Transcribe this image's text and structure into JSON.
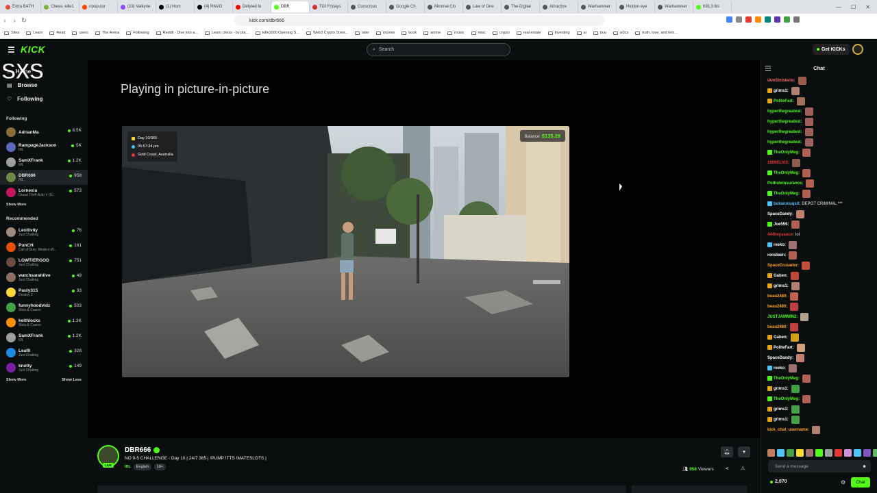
{
  "browser": {
    "tabs": [
      {
        "label": "Extra BATH",
        "color": "#e74c3c"
      },
      {
        "label": "Chess: kille1",
        "color": "#7cb342"
      },
      {
        "label": "r/popular",
        "color": "#ff4500"
      },
      {
        "label": "(23) Valkyrie",
        "color": "#9146ff"
      },
      {
        "label": "(1) Hom",
        "color": "#000000"
      },
      {
        "label": "(4) RNVO",
        "color": "#000000"
      },
      {
        "label": "Defyted fo",
        "color": "#ff0000"
      },
      {
        "label": "DBR",
        "color": "#53fc18",
        "active": true
      },
      {
        "label": "TGI Fridays",
        "color": "#d32f2f"
      },
      {
        "label": "Conscious",
        "color": "#555555"
      },
      {
        "label": "Google Ch",
        "color": "#555555"
      },
      {
        "label": "Minimal Clo",
        "color": "#555555"
      },
      {
        "label": "Law of One",
        "color": "#555555"
      },
      {
        "label": "The Digital",
        "color": "#555555"
      },
      {
        "label": "Attractive",
        "color": "#555555"
      },
      {
        "label": "Warhammer",
        "color": "#555555"
      },
      {
        "label": "Hidden eye",
        "color": "#555555"
      },
      {
        "label": "Warhammer",
        "color": "#555555"
      },
      {
        "label": "KBL3 Bo",
        "color": "#53fc18"
      }
    ],
    "url": "kick.com/dbr666",
    "bookmarks": [
      "Sites",
      "Learn",
      "Read",
      "users",
      "The Arena",
      "Following",
      "Reddit - Dive into a...",
      "Learn chess - by pla...",
      "kille1000 Opening S...",
      "Web3 Crypto Strea...",
      "later",
      "movies",
      "book",
      "anime",
      "music",
      "misc",
      "crypto",
      "real estate",
      "Investing",
      "ai",
      "buy",
      "w3cs",
      "truth, love, and tem..."
    ]
  },
  "header": {
    "logo": "KICK",
    "search_placeholder": "Search",
    "get_kicks": "Get KICKs"
  },
  "sidebar": {
    "nav": [
      {
        "label": "Home",
        "icon": "home-icon"
      },
      {
        "label": "Browse",
        "icon": "browse-icon"
      },
      {
        "label": "Following",
        "icon": "heart-icon"
      }
    ],
    "following_title": "Following",
    "following": [
      {
        "name": "AdrianMa",
        "category": "",
        "viewers": "8.5K",
        "color": "#8a6d3b"
      },
      {
        "name": "RampageJackson",
        "category": "IRL",
        "viewers": "5K",
        "color": "#5c6bc0"
      },
      {
        "name": "SamXFrank",
        "category": "IRL",
        "viewers": "1.2K",
        "color": "#9e9e9e"
      },
      {
        "name": "DBR666",
        "category": "IRL",
        "viewers": "958",
        "color": "#6d8b4a",
        "active": true
      },
      {
        "name": "Lornexia",
        "category": "Grand Theft Auto V (G...",
        "viewers": "573",
        "color": "#c2185b"
      }
    ],
    "show_more": "Show More",
    "recommended_title": "Recommended",
    "recommended": [
      {
        "name": "Lexitivity",
        "category": "Just Chatting",
        "viewers": "76",
        "color": "#a1887f"
      },
      {
        "name": "PunCH",
        "category": "Call of Duty: Modern W...",
        "viewers": "161",
        "color": "#e65100"
      },
      {
        "name": "LOWTIERGOD",
        "category": "Just Chatting",
        "viewers": "751",
        "color": "#6d4c41"
      },
      {
        "name": "watchsarahlive",
        "category": "Just Chatting",
        "viewers": "49",
        "color": "#8d6e63"
      },
      {
        "name": "Pauly315",
        "category": "Destiny 2",
        "viewers": "33",
        "color": "#fdd835"
      },
      {
        "name": "funnyhoodvidz",
        "category": "Slots & Casino",
        "viewers": "503",
        "color": "#43a047"
      },
      {
        "name": "keithlocks",
        "category": "Slots & Casino",
        "viewers": "1.3K",
        "color": "#ff8f00"
      },
      {
        "name": "SamXFrank",
        "category": "IRL",
        "viewers": "1.2K",
        "color": "#9e9e9e"
      },
      {
        "name": "Leafit",
        "category": "Just Chatting",
        "viewers": "328",
        "color": "#1e88e5"
      },
      {
        "name": "knotty",
        "category": "Just Chatting",
        "viewers": "149",
        "color": "#7b1fa2"
      }
    ],
    "show_more_2": "Show More",
    "show_less": "Show Less",
    "watermark": "SXS"
  },
  "player": {
    "pip_text": "Playing in picture-in-picture",
    "overlay_day": "Day 10/365",
    "overlay_time": "05:57:34 pm",
    "overlay_location": "Gold Coast, Australia",
    "balance_label": "Balance:",
    "balance_value": "$135.28"
  },
  "stream": {
    "streamer": "DBR666",
    "live": "LIVE",
    "title": "NO 9-5 CHALLENGE - Day 10 | 24/7 365 | !PUMP !TTS !MATESLOTS |",
    "category": "IRL",
    "tags": [
      "English",
      "18+"
    ],
    "viewers": "958",
    "viewers_label": "Viewers"
  },
  "chat": {
    "title": "Chat",
    "messages": [
      {
        "user": "iAmSinisterio:",
        "color": "#ff6b6b",
        "text": "",
        "emote": "#9c5b4a",
        "badge": ""
      },
      {
        "user": "grims1:",
        "color": "#ffffff",
        "text": "",
        "emote": "#b08070",
        "badge": "#e6a817"
      },
      {
        "user": "PoliteFart:",
        "color": "#53fc18",
        "text": "",
        "emote": "#a0705a",
        "badge": "#e6a817"
      },
      {
        "user": "hyperthegreatest:",
        "color": "#53fc18",
        "text": "",
        "emote": "#a0605a",
        "badge": ""
      },
      {
        "user": "hyperthegreatest:",
        "color": "#53fc18",
        "text": "",
        "emote": "#a0605a",
        "badge": ""
      },
      {
        "user": "hyperthegreatest:",
        "color": "#53fc18",
        "text": "",
        "emote": "#a0605a",
        "badge": ""
      },
      {
        "user": "hyperthegreatest:",
        "color": "#53fc18",
        "text": "",
        "emote": "#a0605a",
        "badge": ""
      },
      {
        "user": "TheOnlyMeg:",
        "color": "#53fc18",
        "text": "",
        "emote": "#b06050",
        "badge": "#53fc18"
      },
      {
        "user": "1909ELVIS:",
        "color": "#e53935",
        "text": "",
        "emote": "#8a6050",
        "badge": ""
      },
      {
        "user": "TheOnlyMeg:",
        "color": "#53fc18",
        "text": "",
        "emote": "#b06050",
        "badge": "#53fc18"
      },
      {
        "user": "Potholeinsurance:",
        "color": "#53fc18",
        "text": "",
        "emote": "#b06050",
        "badge": ""
      },
      {
        "user": "TheOnlyMeg:",
        "color": "#53fc18",
        "text": "",
        "emote": "#b06050",
        "badge": "#53fc18"
      },
      {
        "user": "bukanmuqsit:",
        "color": "#4fc3f7",
        "text": "DEPOT CRIMINAL ***",
        "emote": "",
        "badge": "#4fc3f7"
      },
      {
        "user": "SpaceDandy:",
        "color": "#ffffff",
        "text": "",
        "emote": "#c08070",
        "badge": ""
      },
      {
        "user": "Joe559:",
        "color": "#ffffff",
        "text": "",
        "emote": "#b06050",
        "badge": "#53fc18"
      },
      {
        "user": "444keysauce:",
        "color": "#e53935",
        "text": "lol",
        "emote": "",
        "badge": ""
      },
      {
        "user": "reeko:",
        "color": "#ffffff",
        "text": "",
        "emote": "#a07070",
        "badge": "#4fc3f7"
      },
      {
        "user": "ronsteen:",
        "color": "#ffffff",
        "text": "",
        "emote": "#b06050",
        "badge": ""
      },
      {
        "user": "SpaceCrusader:",
        "color": "#ffa726",
        "text": "",
        "emote": "#c0503a",
        "badge": ""
      },
      {
        "user": "Gaben:",
        "color": "#ffffff",
        "text": "",
        "emote": "#c04a3a",
        "badge": "#e6a817"
      },
      {
        "user": "grims1:",
        "color": "#ffffff",
        "text": "",
        "emote": "#b08070",
        "badge": "#e6a817"
      },
      {
        "user": "beau2480:",
        "color": "#ffa726",
        "text": "",
        "emote": "#c06050",
        "badge": ""
      },
      {
        "user": "beau2480:",
        "color": "#ffa726",
        "text": "",
        "emote": "#c04040",
        "badge": ""
      },
      {
        "user": "JUSTJAMMIN2:",
        "color": "#53fc18",
        "text": "",
        "emote": "#b0a090",
        "badge": ""
      },
      {
        "user": "beau2480:",
        "color": "#ffa726",
        "text": "",
        "emote": "#c04040",
        "badge": ""
      },
      {
        "user": "Gaben:",
        "color": "#ffffff",
        "text": "",
        "emote": "#d4a017",
        "badge": "#e6a817"
      },
      {
        "user": "PoliteFart:",
        "color": "#ffffff",
        "text": "",
        "emote": "#d0a080",
        "badge": "#e6a817"
      },
      {
        "user": "SpaceDandy:",
        "color": "#ffffff",
        "text": "",
        "emote": "#c08070",
        "badge": ""
      },
      {
        "user": "reeko:",
        "color": "#ffffff",
        "text": "",
        "emote": "#a07070",
        "badge": "#4fc3f7"
      },
      {
        "user": "TheOnlyMeg:",
        "color": "#53fc18",
        "text": "",
        "emote": "#b06050",
        "badge": "#53fc18"
      },
      {
        "user": "grims1:",
        "color": "#ffffff",
        "text": "",
        "emote": "#43a047",
        "badge": "#e6a817"
      },
      {
        "user": "TheOnlyMeg:",
        "color": "#53fc18",
        "text": "",
        "emote": "#b06050",
        "badge": "#53fc18"
      },
      {
        "user": "grims1:",
        "color": "#ffffff",
        "text": "",
        "emote": "#43a047",
        "badge": "#e6a817"
      },
      {
        "user": "grims1:",
        "color": "#ffffff",
        "text": "",
        "emote": "#43a047",
        "badge": "#e6a817"
      },
      {
        "user": "kick_chat_username:",
        "color": "#ffa726",
        "text": "",
        "emote": "#b08070",
        "badge": ""
      }
    ],
    "input_placeholder": "Send a message",
    "kicks_balance": "2,070",
    "send_label": "Chat"
  },
  "colors": {
    "accent": "#53fc18",
    "background": "#0b0e0f",
    "player_bg": "#000000"
  }
}
